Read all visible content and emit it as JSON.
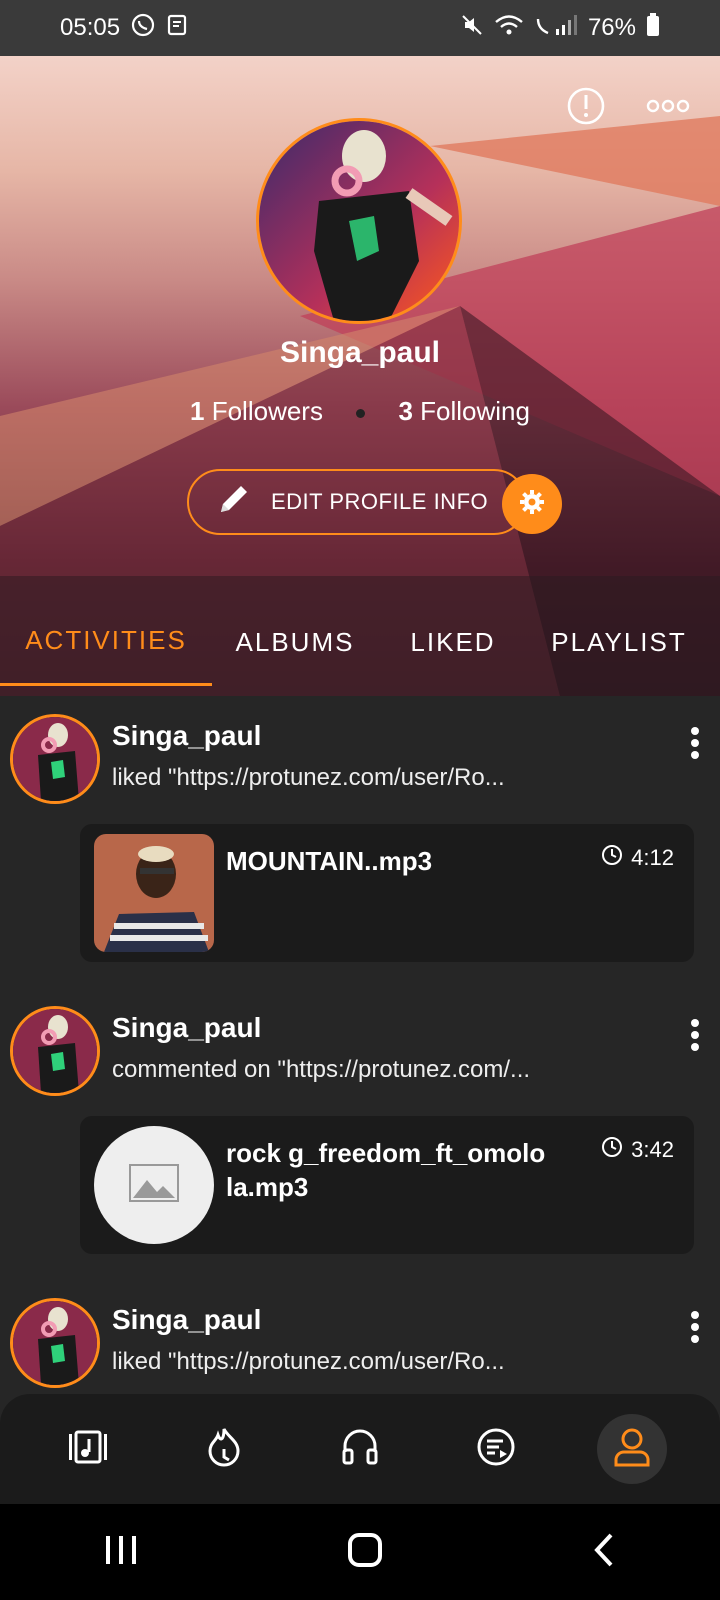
{
  "status": {
    "time": "05:05",
    "battery": "76%"
  },
  "profile": {
    "username": "Singa_paul",
    "followers_count": "1",
    "followers_label": "Followers",
    "following_count": "3",
    "following_label": "Following",
    "edit_label": "EDIT PROFILE INFO"
  },
  "tabs": [
    {
      "label": "ACTIVITIES",
      "active": true
    },
    {
      "label": "ALBUMS",
      "active": false
    },
    {
      "label": "LIKED",
      "active": false
    },
    {
      "label": "PLAYLIST",
      "active": false
    }
  ],
  "feed": [
    {
      "user": "Singa_paul",
      "text": "liked \"https://protunez.com/user/Ro...",
      "track": "MOUNTAIN..mp3",
      "duration": "4:12",
      "thumb": "photo"
    },
    {
      "user": "Singa_paul",
      "text": "commented on \"https://protunez.com/...",
      "track": "rock g_freedom_ft_omolo la.mp3",
      "duration": "3:42",
      "thumb": "placeholder"
    },
    {
      "user": "Singa_paul",
      "text": "liked \"https://protunez.com/user/Ro..."
    }
  ],
  "nav": [
    {
      "icon": "library-icon",
      "active": false
    },
    {
      "icon": "trending-icon",
      "active": false
    },
    {
      "icon": "headphones-icon",
      "active": false
    },
    {
      "icon": "playlist-icon",
      "active": false
    },
    {
      "icon": "profile-icon",
      "active": true
    }
  ],
  "colors": {
    "accent": "#ff8c1a",
    "background": "#262626",
    "card": "#1b1b1b"
  }
}
